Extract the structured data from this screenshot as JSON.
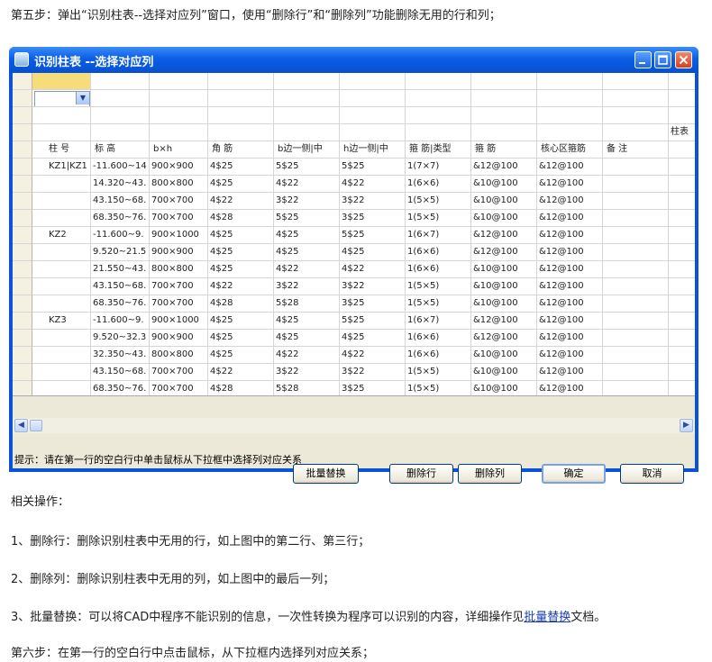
{
  "doc": {
    "step5": "第五步：弹出“识别柱表--选择对应列”窗口，使用“删除行”和“删除列”功能删除无用的行和列；",
    "related": "相关操作：",
    "op1": "1、删除行：删除识别柱表中无用的行，如上图中的第二行、第三行；",
    "op2": "2、删除列：删除识别柱表中无用的列，如上图中的最后一列；",
    "op3_pre": "3、批量替换：可以将CAD中程序不能识别的信息，一次性转换为程序可以识别的内容，详细操作见",
    "op3_link": "批量替换",
    "op3_post": "文档。",
    "step6": "第六步：在第一行的空白行中点击鼠标，从下拉框内选择列对应关系；"
  },
  "window": {
    "title": "识别柱表 --选择对应列",
    "buttons": {
      "batch": "批量替换",
      "del_row": "删除行",
      "del_col": "删除列",
      "ok": "确定",
      "cancel": "取消"
    },
    "hint": "提示：请在第一行的空白行中单击鼠标从下拉框中选择列对应关系"
  },
  "table": {
    "extra_header": "柱表",
    "headers": [
      "柱 号",
      "标 高",
      "b×h",
      "角 筋",
      "b边一侧|中",
      "h边一侧|中",
      "箍 筋|类型",
      "箍 筋",
      "核心区箍筋",
      "备 注",
      ""
    ],
    "rows": [
      [
        "KZ1|KZ1",
        "-11.600~14",
        "900×900",
        "4$25",
        "5$25",
        "5$25",
        "1(7×7)",
        "&12@100",
        "&12@100",
        "",
        ""
      ],
      [
        "",
        "14.320~43.",
        "800×800",
        "4$25",
        "4$22",
        "4$22",
        "1(6×6)",
        "&10@100",
        "&12@100",
        "",
        ""
      ],
      [
        "",
        "43.150~68.",
        "700×700",
        "4$22",
        "3$22",
        "3$22",
        "1(5×5)",
        "&10@100",
        "&12@100",
        "",
        ""
      ],
      [
        "",
        "68.350~76.",
        "700×700",
        "4$28",
        "5$25",
        "3$25",
        "1(5×5)",
        "&10@100",
        "&12@100",
        "",
        ""
      ],
      [
        "KZ2",
        "-11.600~9.",
        "900×1000",
        "4$25",
        "4$25",
        "5$25",
        "1(6×7)",
        "&12@100",
        "&12@100",
        "",
        ""
      ],
      [
        "",
        "9.520~21.5",
        "900×900",
        "4$25",
        "4$25",
        "4$25",
        "1(6×6)",
        "&12@100",
        "&12@100",
        "",
        ""
      ],
      [
        "",
        "21.550~43.",
        "800×800",
        "4$25",
        "4$22",
        "4$22",
        "1(6×6)",
        "&10@100",
        "&12@100",
        "",
        ""
      ],
      [
        "",
        "43.150~68.",
        "700×700",
        "4$22",
        "3$22",
        "3$22",
        "1(5×5)",
        "&10@100",
        "&12@100",
        "",
        ""
      ],
      [
        "",
        "68.350~76.",
        "700×700",
        "4$28",
        "5$28",
        "3$25",
        "1(5×5)",
        "&10@100",
        "&12@100",
        "",
        ""
      ],
      [
        "KZ3",
        "-11.600~9.",
        "900×1000",
        "4$25",
        "4$25",
        "5$25",
        "1(6×7)",
        "&12@100",
        "&12@100",
        "",
        ""
      ],
      [
        "",
        "9.520~32.3",
        "900×900",
        "4$25",
        "4$25",
        "4$25",
        "1(6×6)",
        "&12@100",
        "&12@100",
        "",
        ""
      ],
      [
        "",
        "32.350~43.",
        "800×800",
        "4$25",
        "4$22",
        "4$22",
        "1(6×6)",
        "&10@100",
        "&12@100",
        "",
        ""
      ],
      [
        "",
        "43.150~68.",
        "700×700",
        "4$22",
        "3$22",
        "3$22",
        "1(5×5)",
        "&10@100",
        "&12@100",
        "",
        ""
      ],
      [
        "",
        "68.350~76.",
        "700×700",
        "4$28",
        "5$28",
        "3$25",
        "1(5×5)",
        "&10@100",
        "&12@100",
        "",
        ""
      ]
    ]
  },
  "colors": {
    "titlebar": "#0b5ee6",
    "client": "#ece9d8",
    "selected_cell": "#f7dc7a",
    "link": "#1a3fb0"
  },
  "icons": [
    "window-app-icon",
    "minimize-icon",
    "maximize-icon",
    "close-icon",
    "dropdown-arrow-icon",
    "scroll-left-icon",
    "scroll-right-icon"
  ]
}
